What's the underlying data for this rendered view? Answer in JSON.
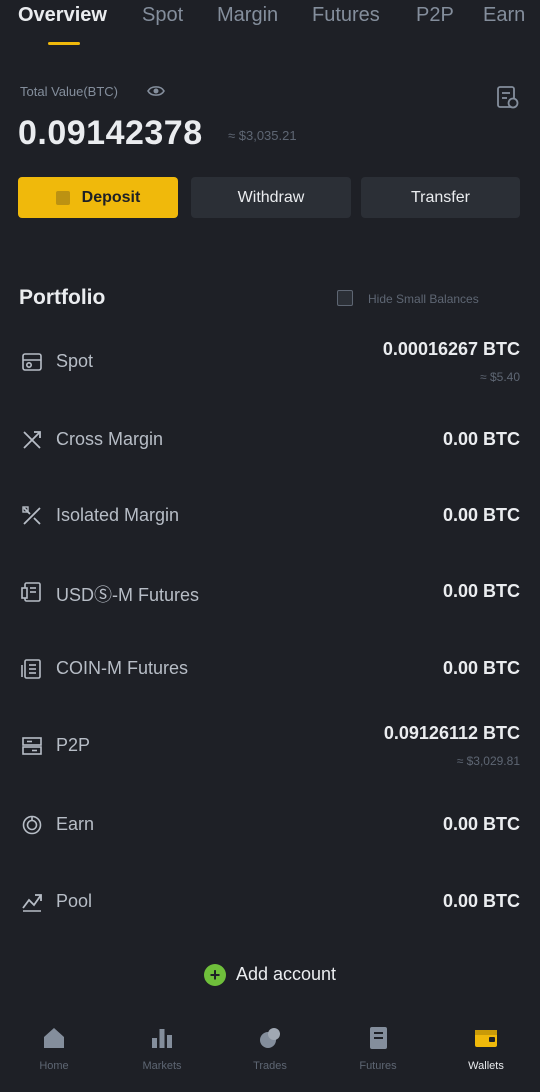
{
  "tabs": [
    {
      "label": "Overview"
    },
    {
      "label": "Spot"
    },
    {
      "label": "Margin"
    },
    {
      "label": "Futures"
    },
    {
      "label": "P2P"
    },
    {
      "label": "Earn"
    }
  ],
  "summary": {
    "est_label": "Total Value(BTC)",
    "balance": "0.09142378",
    "fiat": "≈ $3,035.21"
  },
  "actions": {
    "deposit": "Deposit",
    "withdraw": "Withdraw",
    "transfer": "Transfer"
  },
  "portfolio": {
    "title": "Portfolio",
    "hide_small": "Hide Small Balances",
    "items": [
      {
        "label": "Spot",
        "value": "0.00016267 BTC",
        "sub": "≈ $5.40",
        "icon": "spot-icon"
      },
      {
        "label": "Cross Margin",
        "value": "0.00 BTC",
        "icon": "cross-margin-icon"
      },
      {
        "label": "Isolated Margin",
        "value": "0.00 BTC",
        "icon": "isolated-margin-icon"
      },
      {
        "label": "USDⓈ-M Futures",
        "value": "0.00 BTC",
        "icon": "usdm-futures-icon"
      },
      {
        "label": "COIN-M Futures",
        "value": "0.00 BTC",
        "icon": "coinm-futures-icon"
      },
      {
        "label": "P2P",
        "value": "0.09126112 BTC",
        "sub": "≈ $3,029.81",
        "icon": "p2p-icon"
      },
      {
        "label": "Earn",
        "value": "0.00 BTC",
        "icon": "earn-icon"
      },
      {
        "label": "Pool",
        "value": "0.00 BTC",
        "icon": "pool-icon"
      }
    ],
    "add_account": "Add account"
  },
  "nav": [
    {
      "label": "Home",
      "icon": "home-icon"
    },
    {
      "label": "Markets",
      "icon": "markets-icon"
    },
    {
      "label": "Trades",
      "icon": "trades-icon"
    },
    {
      "label": "Futures",
      "icon": "futures-icon"
    },
    {
      "label": "Wallets",
      "icon": "wallets-icon"
    }
  ],
  "colors": {
    "background": "#1e2026",
    "accent": "#f0b90b",
    "button_dark": "#2b2f36",
    "muted": "#848e9c",
    "add_green": "#6fbf3b"
  }
}
